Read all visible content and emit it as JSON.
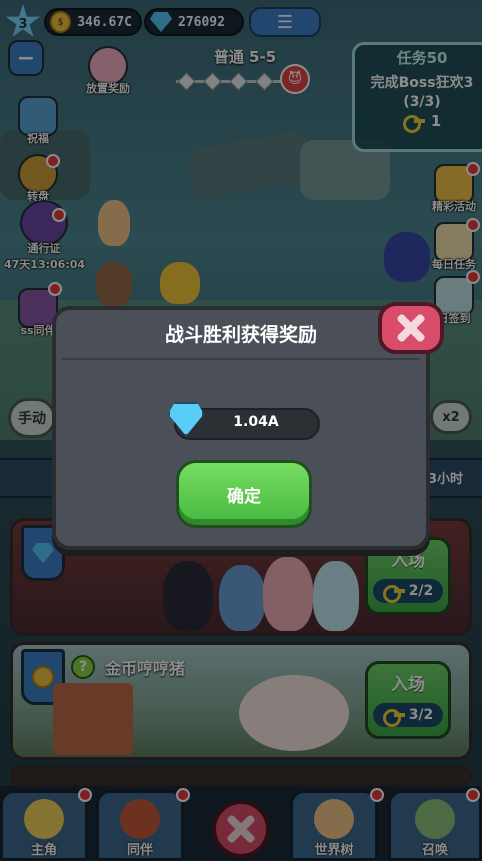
{
  "top_bar": {
    "level": "3",
    "coins": "346.67C",
    "gems": "276092",
    "menu_icon": "list-icon"
  },
  "stage": {
    "label": "普通 5-5",
    "boss_icon": "demon-face-icon"
  },
  "task_panel": {
    "title": "任务50",
    "description": "完成Boss狂欢3",
    "progress": "(3/3)",
    "reward_count": "1"
  },
  "left_icons": [
    {
      "label": "放置奖励",
      "icon": "pig-icon"
    },
    {
      "label": "祝福",
      "icon": "hourglass-icon"
    },
    {
      "label": "转盘",
      "icon": "wheel-icon"
    },
    {
      "label": "通行证",
      "icon": "horned-mask-icon",
      "timer": "47天13:06:04"
    },
    {
      "label": "ss同伴",
      "icon": "witch-icon"
    }
  ],
  "right_icons": [
    {
      "label": "精彩活动",
      "icon": "tent-icon"
    },
    {
      "label": "每日任务",
      "icon": "checklist-icon"
    },
    {
      "label": "日签到",
      "icon": "calendar-icon"
    }
  ],
  "battle": {
    "manual_label": "手动",
    "speed_label": "x2",
    "strip_text": "3小时"
  },
  "modal": {
    "title": "战斗胜利获得奖励",
    "reward_value": "1.04A",
    "confirm_label": "确定"
  },
  "dungeons": [
    {
      "title": "",
      "enter_label": "入场",
      "count": "2/2",
      "color": "#7a3c3c"
    },
    {
      "title": "金币哼哼猪",
      "enter_label": "入场",
      "count": "3/2",
      "color": "#a7c9c9"
    }
  ],
  "bottom_nav": [
    {
      "label": "主角",
      "icon": "hero-icon"
    },
    {
      "label": "同伴",
      "icon": "companion-icon"
    },
    {
      "label": "世界树",
      "icon": "world-tree-icon"
    },
    {
      "label": "召唤",
      "icon": "summon-icon"
    }
  ],
  "colors": {
    "accent_green": "#45b840",
    "close_red": "#d94d6b",
    "gem_blue": "#58cdf7",
    "coin_gold": "#f3c542"
  }
}
